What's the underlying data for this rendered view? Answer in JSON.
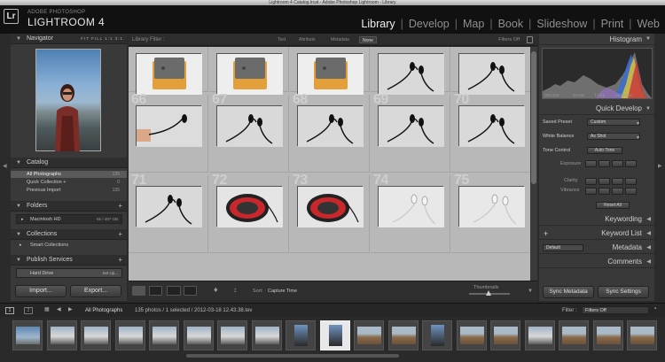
{
  "window": {
    "title": "Lightroom 4 Catalog.lrcat - Adobe Photoshop Lightroom - Library"
  },
  "brand": {
    "logo": "Lr",
    "small": "ADOBE PHOTOSHOP",
    "big": "LIGHTROOM 4"
  },
  "modules": [
    {
      "label": "Library",
      "active": true
    },
    {
      "label": "Develop",
      "active": false
    },
    {
      "label": "Map",
      "active": false
    },
    {
      "label": "Book",
      "active": false
    },
    {
      "label": "Slideshow",
      "active": false
    },
    {
      "label": "Print",
      "active": false
    },
    {
      "label": "Web",
      "active": false
    }
  ],
  "navigator": {
    "title": "Navigator",
    "zoom": "FIT  FILL  1:1  3:1"
  },
  "catalog": {
    "title": "Catalog",
    "items": [
      {
        "label": "All Photographs",
        "count": "135",
        "selected": true
      },
      {
        "label": "Quick Collection +",
        "count": "0",
        "selected": false
      },
      {
        "label": "Previous Import",
        "count": "135",
        "selected": false
      }
    ]
  },
  "folders": {
    "title": "Folders",
    "drive": "Macintosh HD",
    "drive_info": "65 / 497 GB"
  },
  "collections": {
    "title": "Collections",
    "item": "Smart Collections"
  },
  "publish": {
    "title": "Publish Services",
    "item": "Hard Drive",
    "setup": "Set Up..."
  },
  "buttons": {
    "import": "Import...",
    "export": "Export..."
  },
  "filter": {
    "title": "Library Filter :",
    "tabs": [
      {
        "label": "Text",
        "selected": false
      },
      {
        "label": "Attribute",
        "selected": false
      },
      {
        "label": "Metadata",
        "selected": false
      },
      {
        "label": "None",
        "selected": true
      }
    ],
    "status": "Filters Off"
  },
  "grid": {
    "cells": [
      {
        "num": "",
        "kind": "box"
      },
      {
        "num": "",
        "kind": "box"
      },
      {
        "num": "",
        "kind": "box"
      },
      {
        "num": "",
        "kind": "cable"
      },
      {
        "num": "",
        "kind": "cable"
      },
      {
        "num": "66",
        "kind": "hand"
      },
      {
        "num": "67",
        "kind": "cable"
      },
      {
        "num": "68",
        "kind": "cable"
      },
      {
        "num": "69",
        "kind": "cable"
      },
      {
        "num": "70",
        "kind": "cable"
      },
      {
        "num": "71",
        "kind": "cable"
      },
      {
        "num": "72",
        "kind": "red"
      },
      {
        "num": "73",
        "kind": "red"
      },
      {
        "num": "74",
        "kind": "white"
      },
      {
        "num": "75",
        "kind": "white"
      }
    ]
  },
  "toolbar": {
    "sort_label": "Sort:",
    "sort_value": "Capture Time",
    "thumbs_label": "Thumbnails",
    "thumbs_level": 0.4
  },
  "histogram": {
    "title": "Histogram",
    "info": [
      "ISO 200",
      "20 mm",
      "f / 5.6",
      "1/800 sec"
    ]
  },
  "quick_develop": {
    "title": "Quick Develop",
    "saved_preset_label": "Saved Preset",
    "saved_preset_value": "Custom",
    "white_balance_label": "White Balance",
    "white_balance_value": "As Shot",
    "tone_control_label": "Tone Control",
    "auto_tone": "Auto Tone",
    "exposure": "Exposure",
    "clarity": "Clarity",
    "vibrance": "Vibrance",
    "reset": "Reset All"
  },
  "right_panels": {
    "keywording": "Keywording",
    "keyword_list": "Keyword List",
    "metadata": "Metadata",
    "metadata_preset": "Default",
    "comments": "Comments"
  },
  "sync": {
    "metadata": "Sync Metadata",
    "settings": "Sync Settings"
  },
  "filmstrip": {
    "page1": "1",
    "page2": "2",
    "source": "All Photographs",
    "info": "135 photos / 1 selected / 2012-03-18 12.43.38.tev",
    "filter_label": "Filter :",
    "filter_value": "Filters Off",
    "thumbs": [
      {
        "kind": "sky"
      },
      {
        "kind": "winter"
      },
      {
        "kind": "winter"
      },
      {
        "kind": "winter"
      },
      {
        "kind": "winter"
      },
      {
        "kind": "winter"
      },
      {
        "kind": "winter"
      },
      {
        "kind": "winter"
      },
      {
        "kind": "person"
      },
      {
        "kind": "person",
        "sel": true
      },
      {
        "kind": "brown"
      },
      {
        "kind": "brown"
      },
      {
        "kind": "person"
      },
      {
        "kind": "brown"
      },
      {
        "kind": "brown"
      },
      {
        "kind": "winter"
      },
      {
        "kind": "brown"
      },
      {
        "kind": "brown"
      },
      {
        "kind": "brown"
      }
    ]
  },
  "colors": {
    "accent": "#e6e6e6",
    "panel": "#393939",
    "grid_bg": "#b8b8b8"
  }
}
